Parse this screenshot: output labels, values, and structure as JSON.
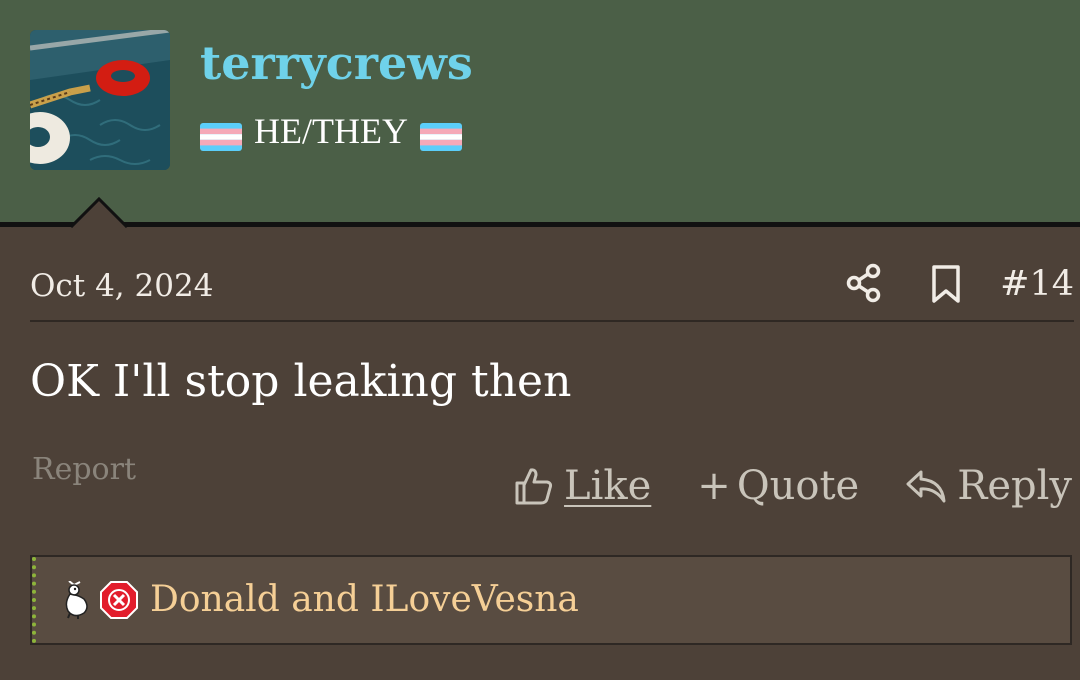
{
  "user": {
    "username": "terrycrews",
    "title": "HE/THEY",
    "flag_icon": "transgender-flag-icon"
  },
  "post": {
    "date": "Oct 4, 2024",
    "number": "#14",
    "message": "OK I'll stop leaking then",
    "share_icon": "share-icon",
    "bookmark_icon": "bookmark-icon"
  },
  "actions": {
    "report": "Report",
    "like": "Like",
    "quote": "Quote",
    "reply": "Reply",
    "quote_prefix": "+"
  },
  "reactions": {
    "text": "Donald and ILoveVesna",
    "icons": [
      "goose-reaction-icon",
      "red-x-reaction-icon"
    ]
  },
  "colors": {
    "header_bg": "#4b5f47",
    "post_bg": "#4d4138",
    "username": "#6fd2ea",
    "reactions_text": "#f5cf96",
    "reactions_accent": "#8db53a"
  }
}
